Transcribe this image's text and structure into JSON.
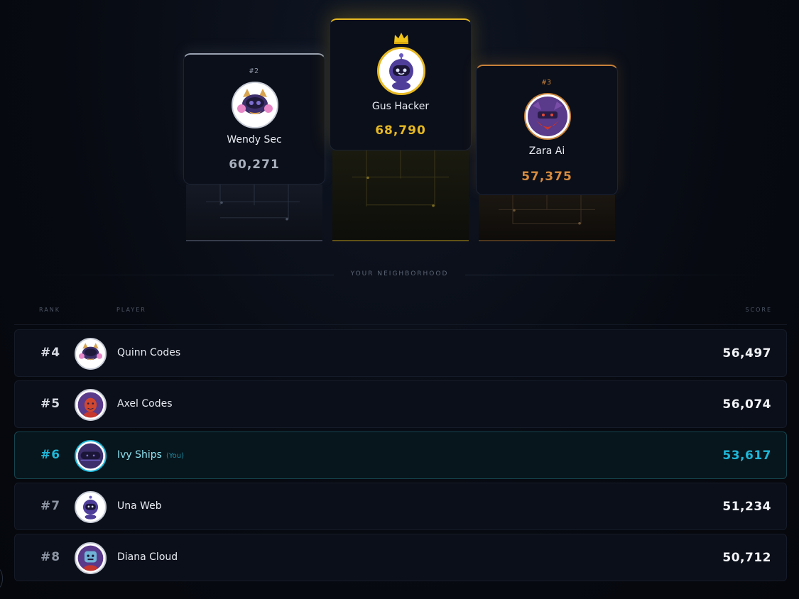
{
  "podium": {
    "second": {
      "rank_label": "#2",
      "name": "Wendy Sec",
      "score": "60,271",
      "avatar": "alien-cat-avatar"
    },
    "first": {
      "name": "Gus Hacker",
      "score": "68,790",
      "avatar": "robot-avatar",
      "icon": "crown-icon"
    },
    "third": {
      "rank_label": "#3",
      "name": "Zara Ai",
      "score": "57,375",
      "avatar": "ninja-avatar"
    }
  },
  "section_label": "YOUR NEIGHBORHOOD",
  "table": {
    "headers": {
      "rank": "RANK",
      "player": "PLAYER",
      "score": "SCORE"
    },
    "rows": [
      {
        "rank": "#4",
        "name": "Quinn Codes",
        "score": "56,497",
        "you": false
      },
      {
        "rank": "#5",
        "name": "Axel Codes",
        "score": "56,074",
        "you": false
      },
      {
        "rank": "#6",
        "name": "Ivy Ships",
        "you_tag": "(You)",
        "score": "53,617",
        "you": true
      },
      {
        "rank": "#7",
        "name": "Una Web",
        "score": "51,234",
        "you": false
      },
      {
        "rank": "#8",
        "name": "Diana Cloud",
        "score": "50,712",
        "you": false
      }
    ]
  },
  "colors": {
    "gold": "#e7b923",
    "silver": "#aab1be",
    "bronze": "#d98c3e",
    "you_accent": "#1fb6d8"
  }
}
